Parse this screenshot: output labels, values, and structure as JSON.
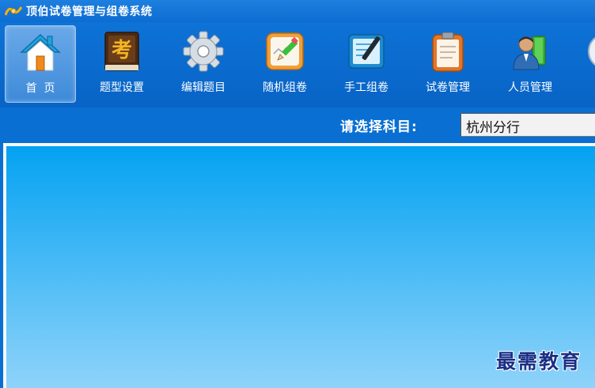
{
  "window": {
    "title": "顶伯试卷管理与组卷系统"
  },
  "toolbar": {
    "items": [
      {
        "label": "首  页",
        "icon": "home-icon",
        "active": true
      },
      {
        "label": "题型设置",
        "icon": "exam-book-icon",
        "active": false
      },
      {
        "label": "编辑题目",
        "icon": "gear-icon",
        "active": false
      },
      {
        "label": "随机组卷",
        "icon": "pencil-sketch-icon",
        "active": false
      },
      {
        "label": "手工组卷",
        "icon": "notebook-pen-icon",
        "active": false
      },
      {
        "label": "试卷管理",
        "icon": "clipboard-icon",
        "active": false
      },
      {
        "label": "人员管理",
        "icon": "users-icon",
        "active": false
      }
    ]
  },
  "subject": {
    "label": "请选择科目:",
    "selected": "杭州分行"
  },
  "watermark": {
    "text": "最需教育"
  },
  "colors": {
    "window_bg": "#0a6fd2",
    "content_top": "#04a2f2",
    "content_bottom": "#8fd3fa",
    "watermark": "#1a2f86"
  }
}
